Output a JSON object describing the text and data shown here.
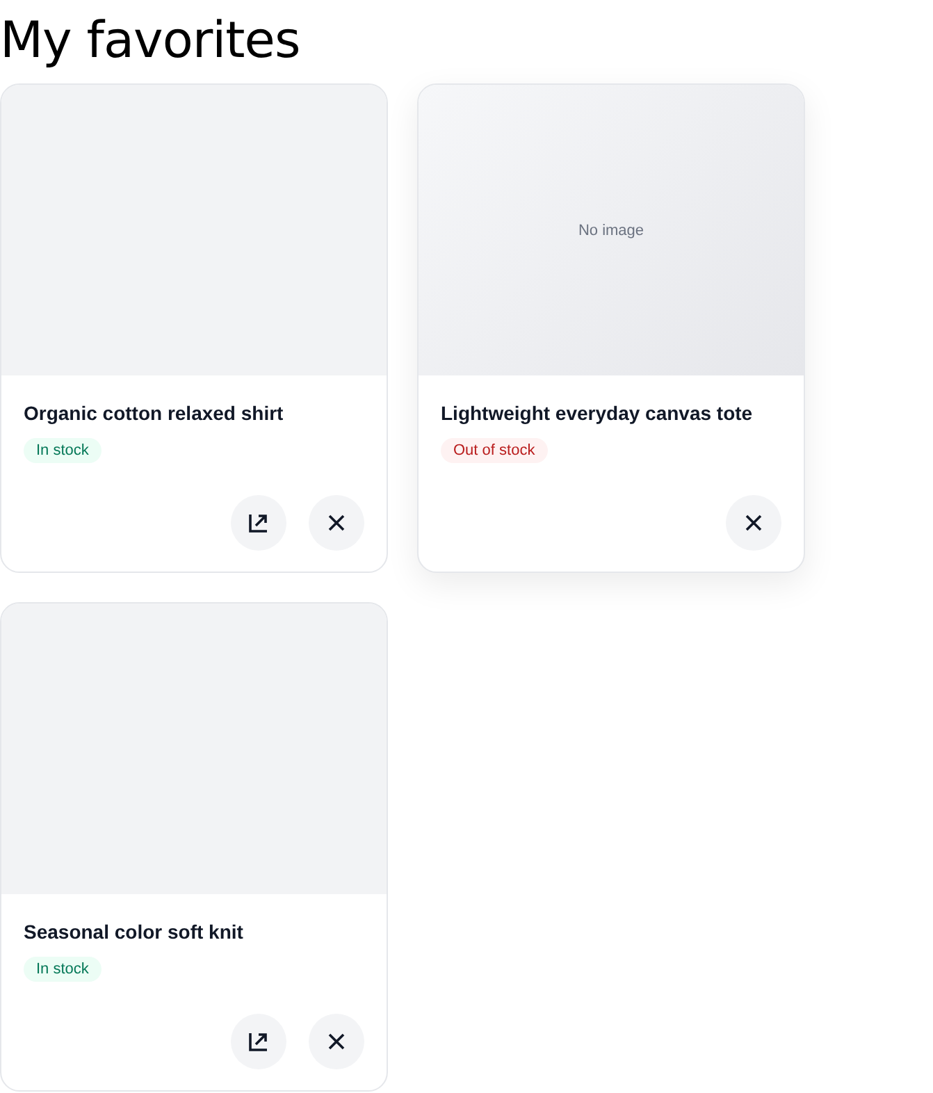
{
  "title": "My favorites",
  "items": [
    {
      "name": "Organic cotton relaxed shirt",
      "image": {
        "kind": "blank"
      },
      "stock": {
        "label": "In stock",
        "available": true
      },
      "raised": false,
      "actions": [
        {
          "kind": "open"
        },
        {
          "kind": "remove"
        }
      ]
    },
    {
      "name": "Lightweight everyday canvas tote",
      "image": {
        "kind": "placeholder",
        "text": "No image"
      },
      "stock": {
        "label": "Out of stock",
        "available": false
      },
      "raised": true,
      "actions": [
        {
          "kind": "remove"
        }
      ]
    },
    {
      "name": "Seasonal color soft knit",
      "image": {
        "kind": "blank"
      },
      "stock": {
        "label": "In stock",
        "available": true
      },
      "raised": false,
      "actions": [
        {
          "kind": "open"
        },
        {
          "kind": "remove"
        }
      ]
    }
  ]
}
